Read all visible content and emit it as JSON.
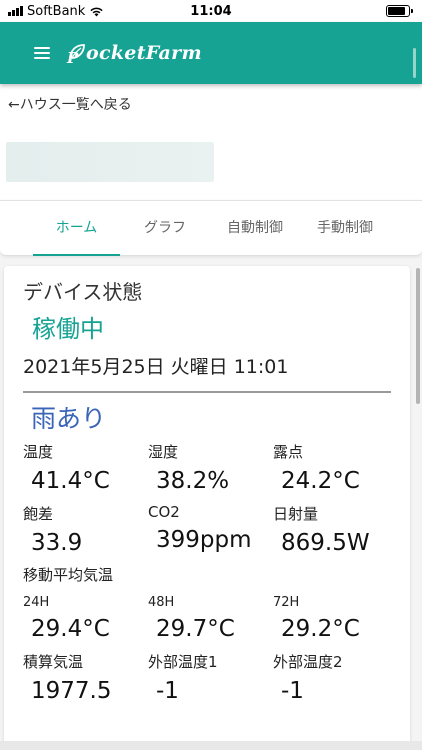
{
  "status_bar": {
    "carrier": "SoftBank",
    "time": "11:04",
    "icons": [
      "signal-icon",
      "wifi-icon",
      "battery-icon"
    ]
  },
  "app_bar": {
    "logo_text": "ocketFarm",
    "brand_color": "#16a394"
  },
  "nav": {
    "back_label": "←ハウス一覧へ戻る"
  },
  "tabs": [
    {
      "label": "ホーム",
      "active": true
    },
    {
      "label": "グラフ",
      "active": false
    },
    {
      "label": "自動制御",
      "active": false
    },
    {
      "label": "手動制御",
      "active": false
    }
  ],
  "device": {
    "title": "デバイス状態",
    "state": "稼働中",
    "datetime": "2021年5月25日 火曜日 11:01",
    "weather": "雨あり"
  },
  "readings": {
    "temperature": {
      "label": "温度",
      "value": "41.4°C"
    },
    "humidity": {
      "label": "湿度",
      "value": "38.2%"
    },
    "dewpoint": {
      "label": "露点",
      "value": "24.2°C"
    },
    "saturation_deficit": {
      "label": "飽差",
      "value": "33.9"
    },
    "co2": {
      "label": "CO2",
      "value": "399ppm"
    },
    "solar_radiation": {
      "label": "日射量",
      "value": "869.5W"
    }
  },
  "moving_average": {
    "label": "移動平均気温",
    "h24": {
      "label": "24H",
      "value": "29.4°C"
    },
    "h48": {
      "label": "48H",
      "value": "29.7°C"
    },
    "h72": {
      "label": "72H",
      "value": "29.2°C"
    }
  },
  "extra": {
    "accumulated_temp": {
      "label": "積算気温",
      "value": "1977.5"
    },
    "outside_temp1": {
      "label": "外部温度1",
      "value": "-1"
    },
    "outside_temp2": {
      "label": "外部温度2",
      "value": "-1"
    }
  }
}
